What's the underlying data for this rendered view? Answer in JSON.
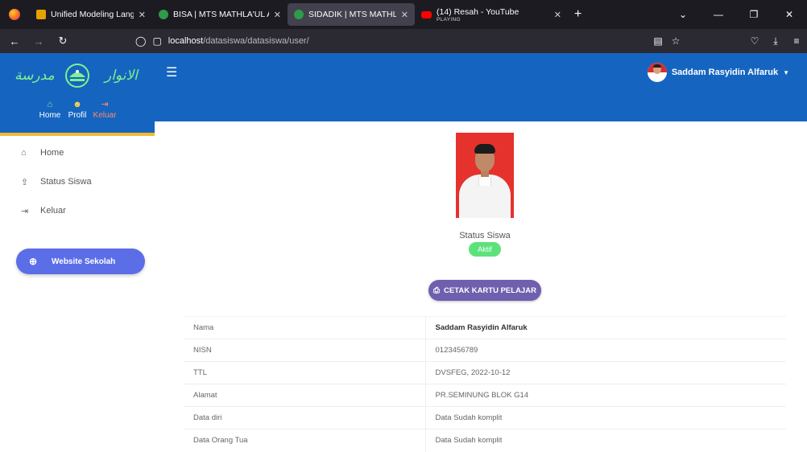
{
  "browser": {
    "tabs": [
      {
        "title": "Unified Modeling Language (UM",
        "icon": "uml-favicon"
      },
      {
        "title": "BISA | MTS MATHLA'UL ANWAR",
        "icon": "school-favicon"
      },
      {
        "title": "SIDADIK | MTS MATHLA'UL ANW",
        "icon": "school-favicon",
        "active": true
      },
      {
        "title": "(14) Resah - YouTube",
        "subtitle": "PLAYING",
        "icon": "youtube-favicon"
      }
    ],
    "url": {
      "host": "localhost",
      "path": "/datasiswa/datasiswa/user/"
    }
  },
  "sidebar": {
    "quick_links": [
      {
        "label": "Home",
        "icon": "home-icon"
      },
      {
        "label": "Profil",
        "icon": "user-icon"
      },
      {
        "label": "Keluar",
        "icon": "sign-out-icon"
      }
    ],
    "menu": [
      {
        "label": "Home",
        "icon": "home-icon"
      },
      {
        "label": "Status Siswa",
        "icon": "upload-icon"
      },
      {
        "label": "Keluar",
        "icon": "sign-out-icon"
      }
    ],
    "website_button": "Website Sekolah"
  },
  "header": {
    "user_name": "Saddam Rasyidin Alfaruk"
  },
  "profile": {
    "status_label": "Status Siswa",
    "status_value": "Aktif",
    "print_button": "CETAK KARTU PELAJAR",
    "rows": [
      {
        "key": "Nama",
        "value": "Saddam Rasyidin Alfaruk"
      },
      {
        "key": "NISN",
        "value": "0123456789"
      },
      {
        "key": "TTL",
        "value": "DVSFEG, 2022-10-12"
      },
      {
        "key": "Alamat",
        "value": "PR.SEMINUNG BLOK G14"
      },
      {
        "key": "Data diri",
        "value": "Data Sudah komplit"
      },
      {
        "key": "Data Orang Tua",
        "value": "Data Sudah komplit"
      }
    ]
  },
  "colors": {
    "primary": "#1565c0",
    "accent_bar": "#f5b731",
    "status_active": "#5ce27b",
    "print_button": "#6f5fae",
    "website_button": "#5b6ee8"
  }
}
